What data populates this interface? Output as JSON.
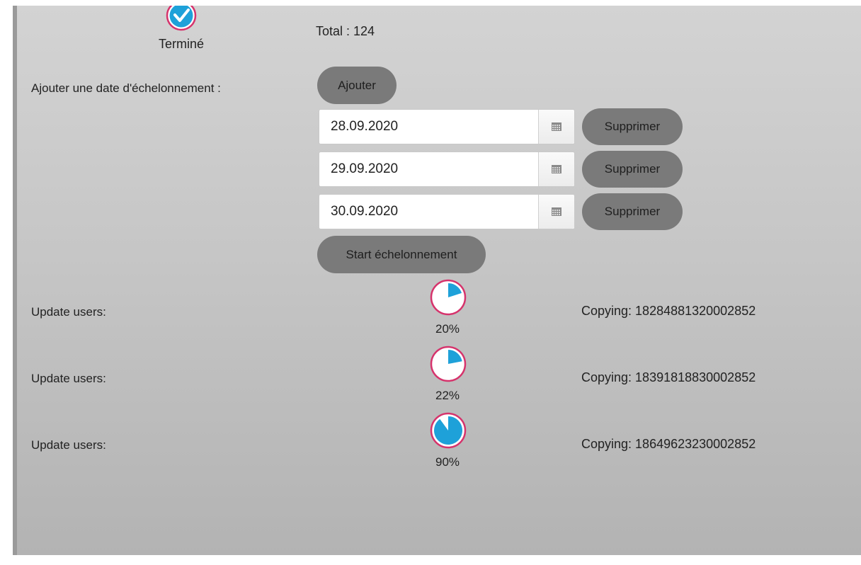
{
  "status": {
    "done_label": "Terminé",
    "done_icon": "check-circle-icon",
    "total_text": "Total : 124"
  },
  "scheduling": {
    "add_label": "Ajouter une date d'échelonnement :",
    "add_button": "Ajouter",
    "dates": [
      {
        "value": "28.09.2020",
        "delete_label": "Supprimer"
      },
      {
        "value": "29.09.2020",
        "delete_label": "Supprimer"
      },
      {
        "value": "30.09.2020",
        "delete_label": "Supprimer"
      }
    ],
    "calendar_icon": "calendar-icon",
    "start_button": "Start échelonnement"
  },
  "updates": [
    {
      "label": "Update users:",
      "progress": 0.2,
      "percent_text": "20%",
      "copying_text": "Copying: 18284881320002852"
    },
    {
      "label": "Update users:",
      "progress": 0.22,
      "percent_text": "22%",
      "copying_text": "Copying: 18391818830002852"
    },
    {
      "label": "Update users:",
      "progress": 0.9,
      "percent_text": "90%",
      "copying_text": "Copying: 18649623230002852"
    }
  ],
  "colors": {
    "accent_blue": "#1ea1d9",
    "accent_ring": "#d6336c",
    "button_gray": "#7a7a7a"
  }
}
